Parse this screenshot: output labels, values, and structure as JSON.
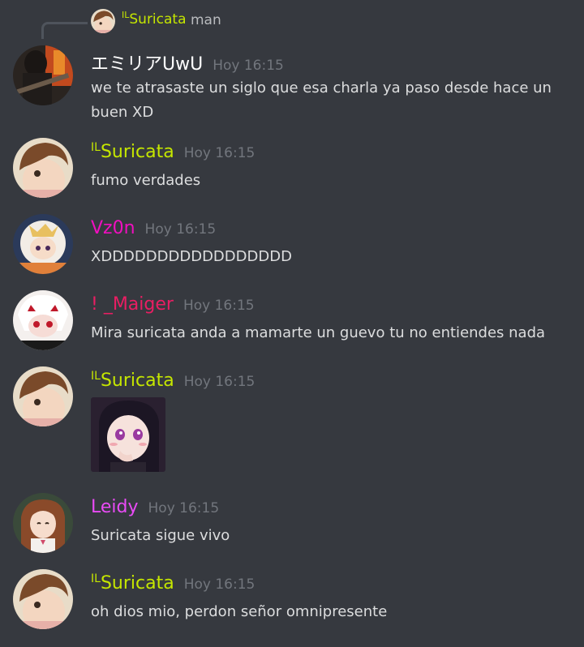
{
  "reply": {
    "prefix": "IL",
    "name": "Suricata",
    "text": "man",
    "name_color": "#c5e600"
  },
  "messages": [
    {
      "author": "エミリアUwU",
      "author_prefix": "",
      "color": "#ffffff",
      "time": "Hoy 16:15",
      "text": "we te atrasaste un siglo que esa charla ya paso desde hace un buen XD",
      "avatar": "guitarist-avatar"
    },
    {
      "author": "Suricata",
      "author_prefix": "IL",
      "color": "#c5e600",
      "time": "Hoy 16:15",
      "text": "fumo verdades",
      "avatar": "anime-girl-avatar"
    },
    {
      "author": "Vz0n",
      "author_prefix": "",
      "color": "#f00fbf",
      "time": "Hoy 16:15",
      "text": "XDDDDDDDDDDDDDDDDD",
      "avatar": "paimon-avatar"
    },
    {
      "author": "! _Maiger",
      "author_prefix": "",
      "color": "#e91e63",
      "time": "Hoy 16:15",
      "text": "Mira suricata anda a mamarte un guevo tu no entiendes nada",
      "avatar": "white-hair-anime-avatar"
    },
    {
      "author": "Suricata",
      "author_prefix": "IL",
      "color": "#c5e600",
      "time": "Hoy 16:15",
      "text": "",
      "avatar": "anime-girl-avatar",
      "attachment": "anime-girl-image"
    },
    {
      "author": "Leidy",
      "author_prefix": "",
      "color": "#e94bf5",
      "time": "Hoy 16:15",
      "text": "Suricata sigue vivo",
      "avatar": "brown-hair-anime-avatar"
    },
    {
      "author": "Suricata",
      "author_prefix": "IL",
      "color": "#c5e600",
      "time": "Hoy 16:15",
      "text": "oh dios mio, perdon señor omnipresente",
      "avatar": "anime-girl-avatar"
    }
  ]
}
